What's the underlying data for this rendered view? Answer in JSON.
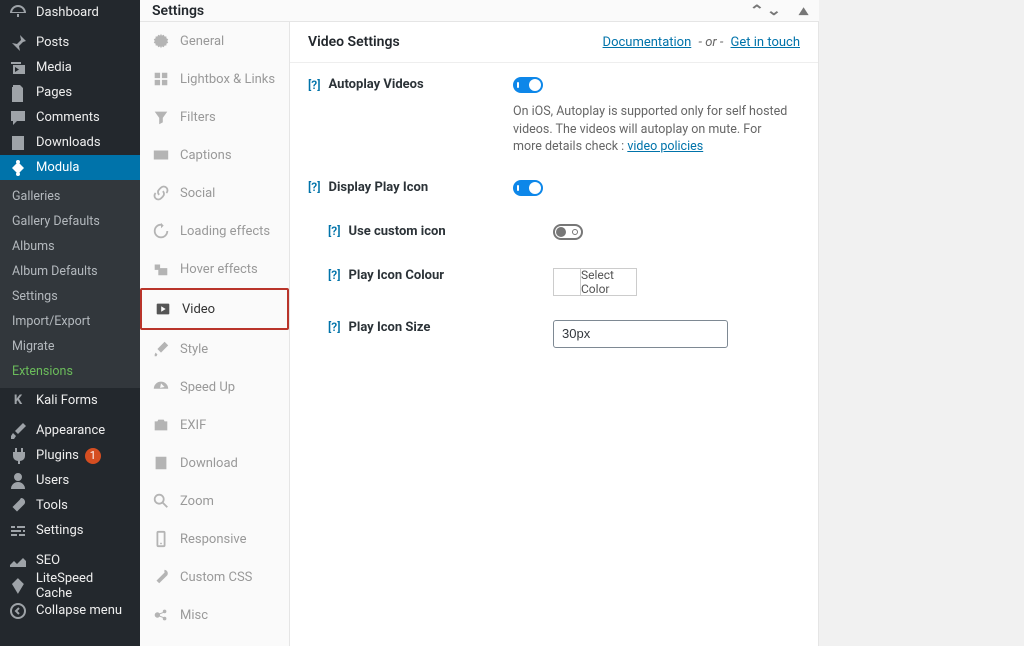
{
  "adminmenu": {
    "items": [
      {
        "label": "Dashboard",
        "icon": "dash"
      },
      {
        "label": "Posts",
        "icon": "pin"
      },
      {
        "label": "Media",
        "icon": "media"
      },
      {
        "label": "Pages",
        "icon": "page"
      },
      {
        "label": "Comments",
        "icon": "comment"
      },
      {
        "label": "Downloads",
        "icon": "download"
      },
      {
        "label": "Modula",
        "icon": "modula",
        "active": true
      },
      {
        "label": "Kali Forms",
        "icon": "k"
      },
      {
        "label": "Appearance",
        "icon": "brush"
      },
      {
        "label": "Plugins",
        "icon": "plug",
        "badge": "1"
      },
      {
        "label": "Users",
        "icon": "user"
      },
      {
        "label": "Tools",
        "icon": "tools"
      },
      {
        "label": "Settings",
        "icon": "sliders"
      },
      {
        "label": "SEO",
        "icon": "seo"
      },
      {
        "label": "LiteSpeed Cache",
        "icon": "litespeed"
      },
      {
        "label": "Collapse menu",
        "icon": "collapse"
      }
    ],
    "submenu": {
      "items": [
        "Galleries",
        "Gallery Defaults",
        "Albums",
        "Album Defaults",
        "Settings",
        "Import/Export",
        "Migrate",
        "Extensions"
      ]
    }
  },
  "settings_panel": {
    "header": "Settings",
    "tabs": [
      {
        "label": "General",
        "icon": "gear"
      },
      {
        "label": "Lightbox & Links",
        "icon": "grid"
      },
      {
        "label": "Filters",
        "icon": "filter"
      },
      {
        "label": "Captions",
        "icon": "caption"
      },
      {
        "label": "Social",
        "icon": "link"
      },
      {
        "label": "Loading effects",
        "icon": "spinner"
      },
      {
        "label": "Hover effects",
        "icon": "hover"
      },
      {
        "label": "Video",
        "icon": "play",
        "current": true
      },
      {
        "label": "Style",
        "icon": "brush2"
      },
      {
        "label": "Speed Up",
        "icon": "gauge"
      },
      {
        "label": "EXIF",
        "icon": "camera"
      },
      {
        "label": "Download",
        "icon": "dl"
      },
      {
        "label": "Zoom",
        "icon": "zoom"
      },
      {
        "label": "Responsive",
        "icon": "phone"
      },
      {
        "label": "Custom CSS",
        "icon": "wrench"
      },
      {
        "label": "Misc",
        "icon": "misc"
      }
    ],
    "content": {
      "title": "Video Settings",
      "doc_link": "Documentation",
      "or": " - or - ",
      "contact_link": "Get in touch",
      "fields": {
        "autoplay": {
          "label": "Autoplay Videos",
          "hint": "?",
          "toggle": true,
          "desc_pre": "On iOS, Autoplay is supported only for self hosted videos. The videos will autoplay on mute. For more details check : ",
          "desc_link": "video policies"
        },
        "display_icon": {
          "label": "Display Play Icon",
          "hint": "?",
          "toggle": true
        },
        "custom_icon": {
          "label": "Use custom icon",
          "hint": "?",
          "toggle": false
        },
        "icon_colour": {
          "label": "Play Icon Colour",
          "hint": "?",
          "button": "Select Color"
        },
        "icon_size": {
          "label": "Play Icon Size",
          "hint": "?",
          "value": "30px"
        }
      }
    }
  }
}
